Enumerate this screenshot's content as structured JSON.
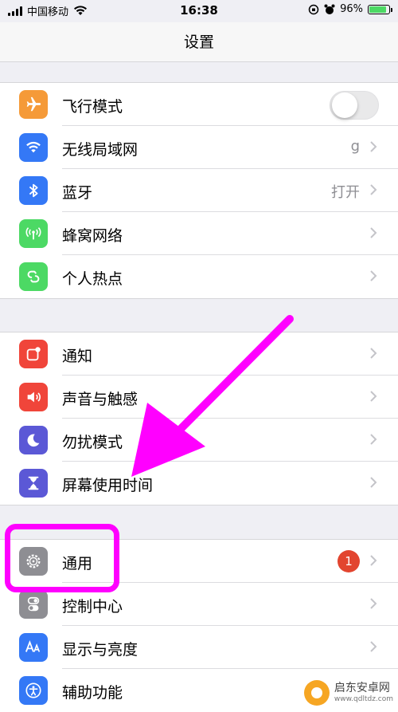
{
  "status_bar": {
    "carrier": "中国移动",
    "time": "16:38",
    "battery": "96%",
    "battery_level": 0.96
  },
  "nav": {
    "title": "设置"
  },
  "groups": [
    [
      {
        "name": "airplane",
        "label": "飞行模式",
        "icon": "airplane-icon",
        "color": "#f59a38",
        "toggle": false
      },
      {
        "name": "wifi",
        "label": "无线局域网",
        "icon": "wifi-icon",
        "color": "#3478f6",
        "value": "g"
      },
      {
        "name": "bluetooth",
        "label": "蓝牙",
        "icon": "bluetooth-icon",
        "color": "#3478f6",
        "value": "打开"
      },
      {
        "name": "cellular",
        "label": "蜂窝网络",
        "icon": "cellular-icon",
        "color": "#4cd964"
      },
      {
        "name": "hotspot",
        "label": "个人热点",
        "icon": "hotspot-icon",
        "color": "#4cd964"
      }
    ],
    [
      {
        "name": "notifications",
        "label": "通知",
        "icon": "notifications-icon",
        "color": "#f0453a"
      },
      {
        "name": "sounds",
        "label": "声音与触感",
        "icon": "speaker-icon",
        "color": "#f0453a"
      },
      {
        "name": "dnd",
        "label": "勿扰模式",
        "icon": "moon-icon",
        "color": "#5b58d6"
      },
      {
        "name": "screen-time",
        "label": "屏幕使用时间",
        "icon": "hourglass-icon",
        "color": "#5b58d6"
      }
    ],
    [
      {
        "name": "general",
        "label": "通用",
        "icon": "gear-icon",
        "color": "#8e8e93",
        "badge": "1"
      },
      {
        "name": "control-center",
        "label": "控制中心",
        "icon": "switches-icon",
        "color": "#8e8e93"
      },
      {
        "name": "display",
        "label": "显示与亮度",
        "icon": "aa-icon",
        "color": "#3478f6"
      },
      {
        "name": "accessibility",
        "label": "辅助功能",
        "icon": "accessibility-icon",
        "color": "#3478f6"
      }
    ]
  ],
  "watermark": {
    "text": "启东安卓网",
    "url": "www.qdltdz.com"
  },
  "colors": {
    "highlight": "#ff00ff",
    "background": "#efeff4"
  }
}
